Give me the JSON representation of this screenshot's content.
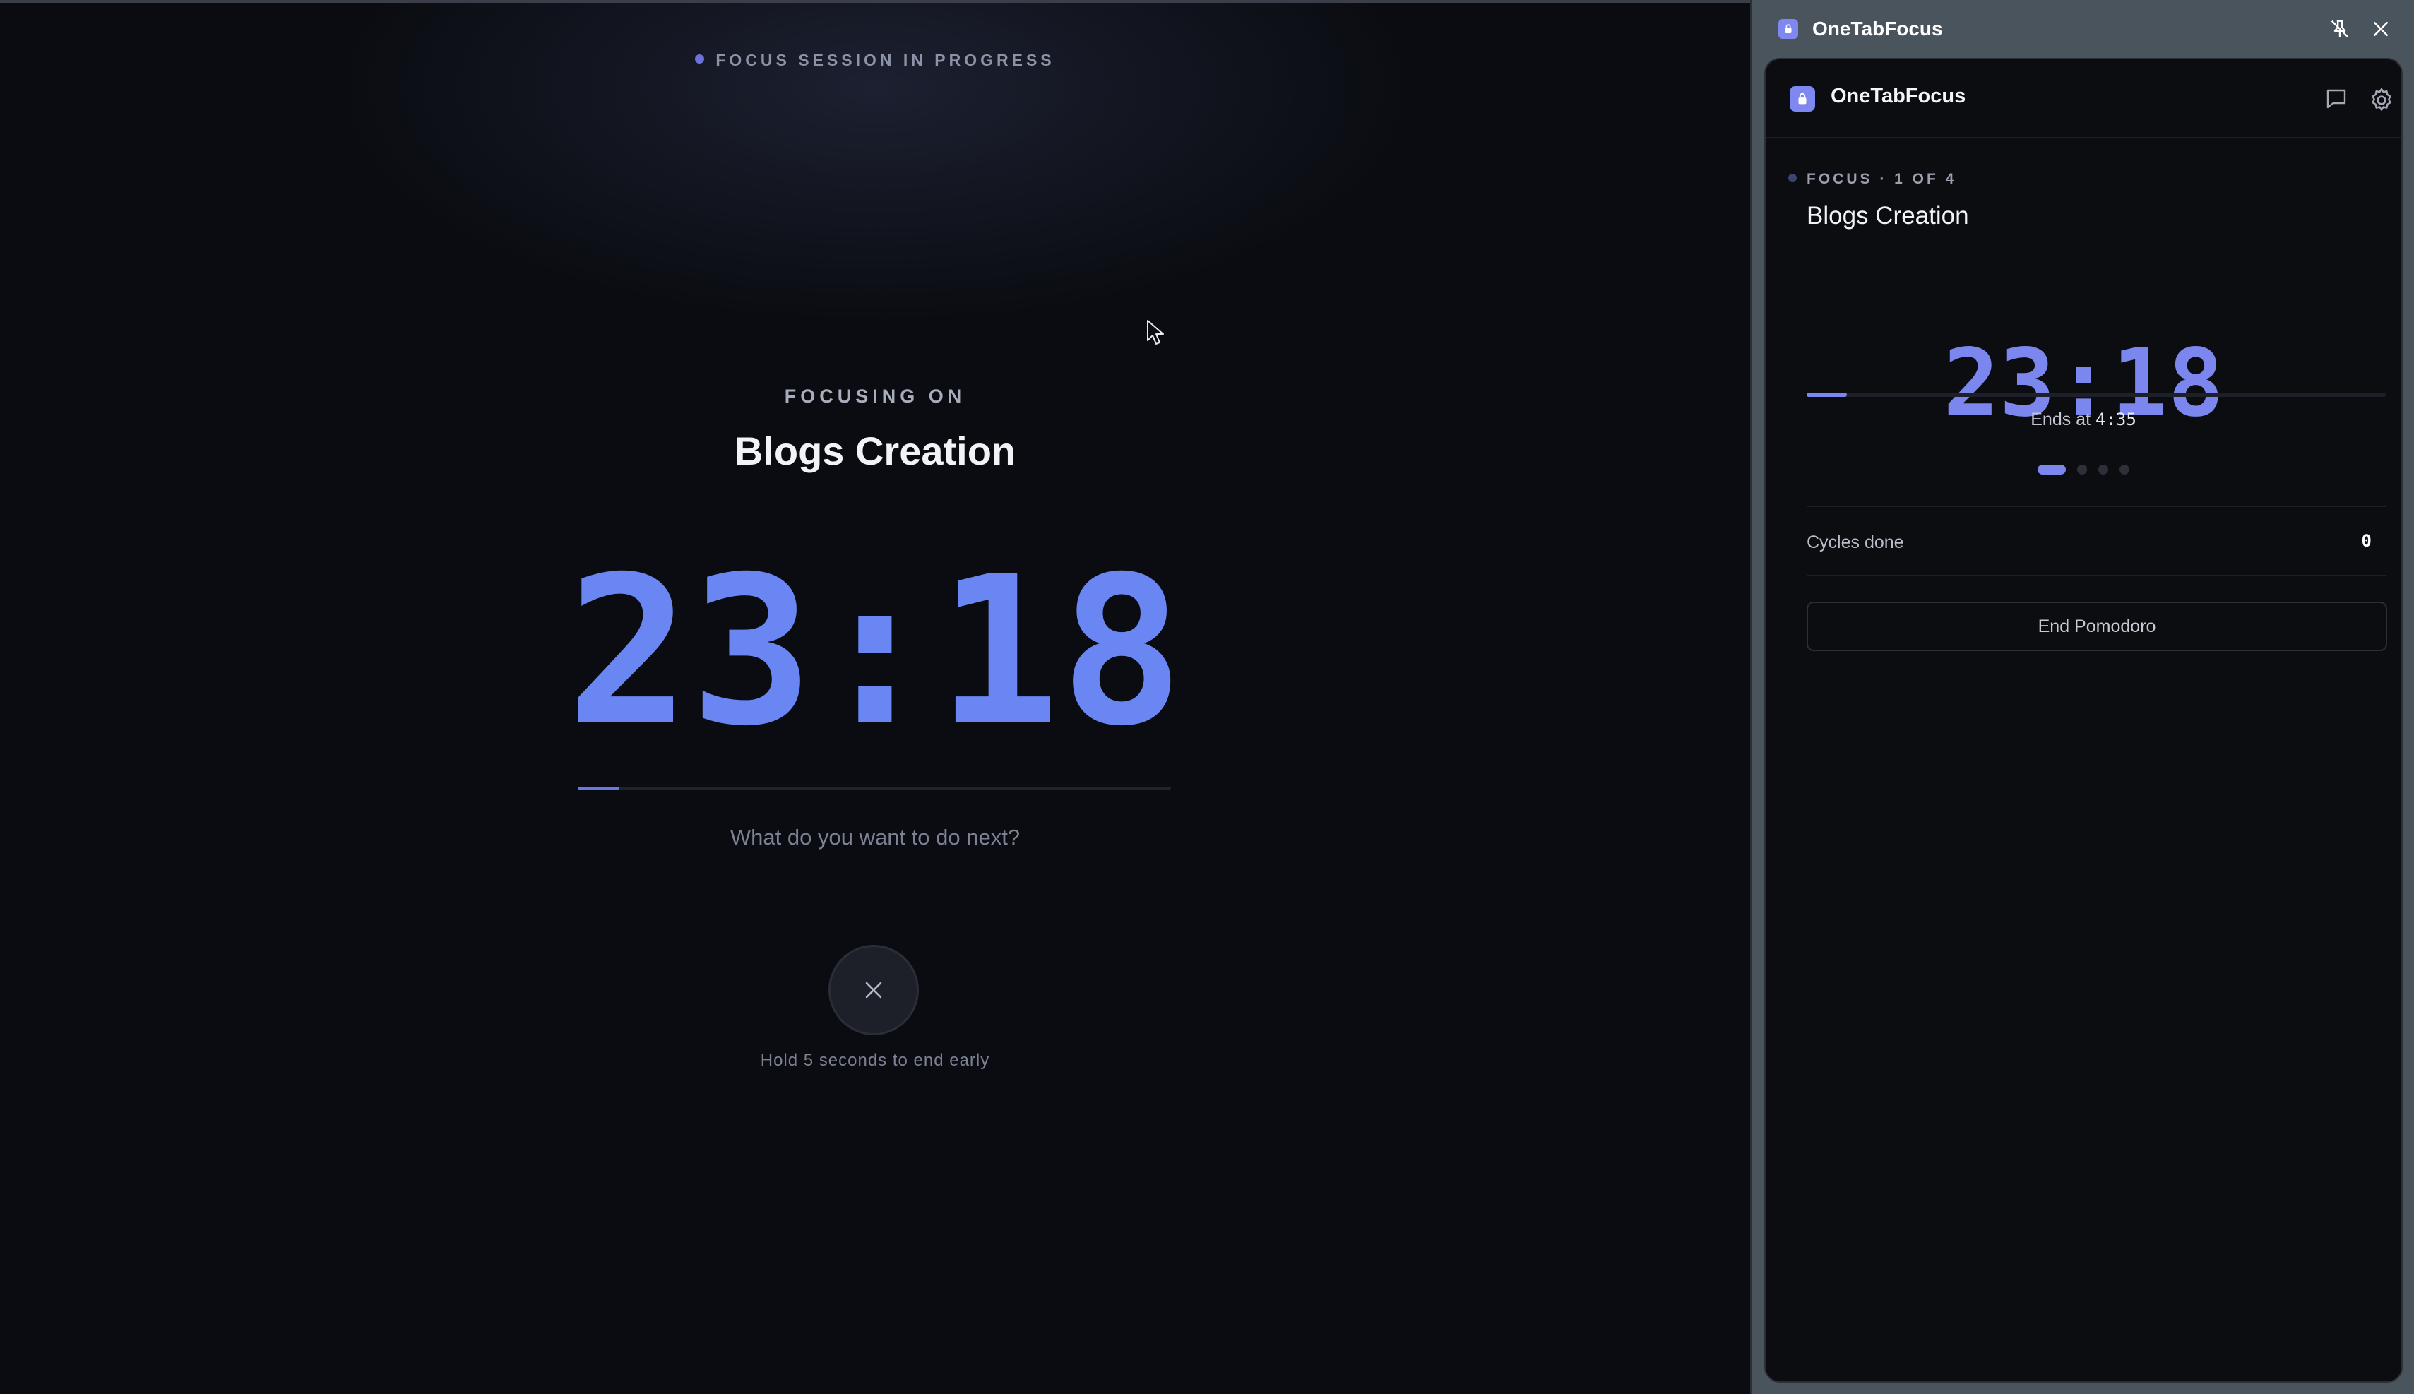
{
  "main": {
    "status_text": "FOCUS SESSION IN PROGRESS",
    "focusing_on_label": "FOCUSING ON",
    "task_title": "Blogs Creation",
    "timer": "23:18",
    "progress_fraction": 0.07,
    "next_prompt": "What do you want to do next?",
    "hold_hint": "Hold 5 seconds to end early",
    "end_button_icon": "close-icon"
  },
  "side_window": {
    "title": "OneTabFocus",
    "titlebar_icons": [
      "lock-icon",
      "unpin-icon",
      "close-icon"
    ],
    "panel": {
      "app_name": "OneTabFocus",
      "header_icons": [
        "lock-icon",
        "feedback-icon",
        "settings-icon"
      ],
      "phase_label": "FOCUS · 1 OF 4",
      "task_title": "Blogs Creation",
      "timer": "23:18",
      "progress_fraction": 0.07,
      "ends_at_prefix": "Ends at",
      "ends_at_time": "4:35",
      "cycles_total": 4,
      "cycles_current": 1,
      "cycles_done_label": "Cycles done",
      "cycles_done_value": "0",
      "end_button_label": "End Pomodoro"
    }
  },
  "colors": {
    "accent": "#6a86f2",
    "panel_accent": "#7b86ee",
    "background": "#0a0c11",
    "window_chrome": "#4a545d"
  }
}
